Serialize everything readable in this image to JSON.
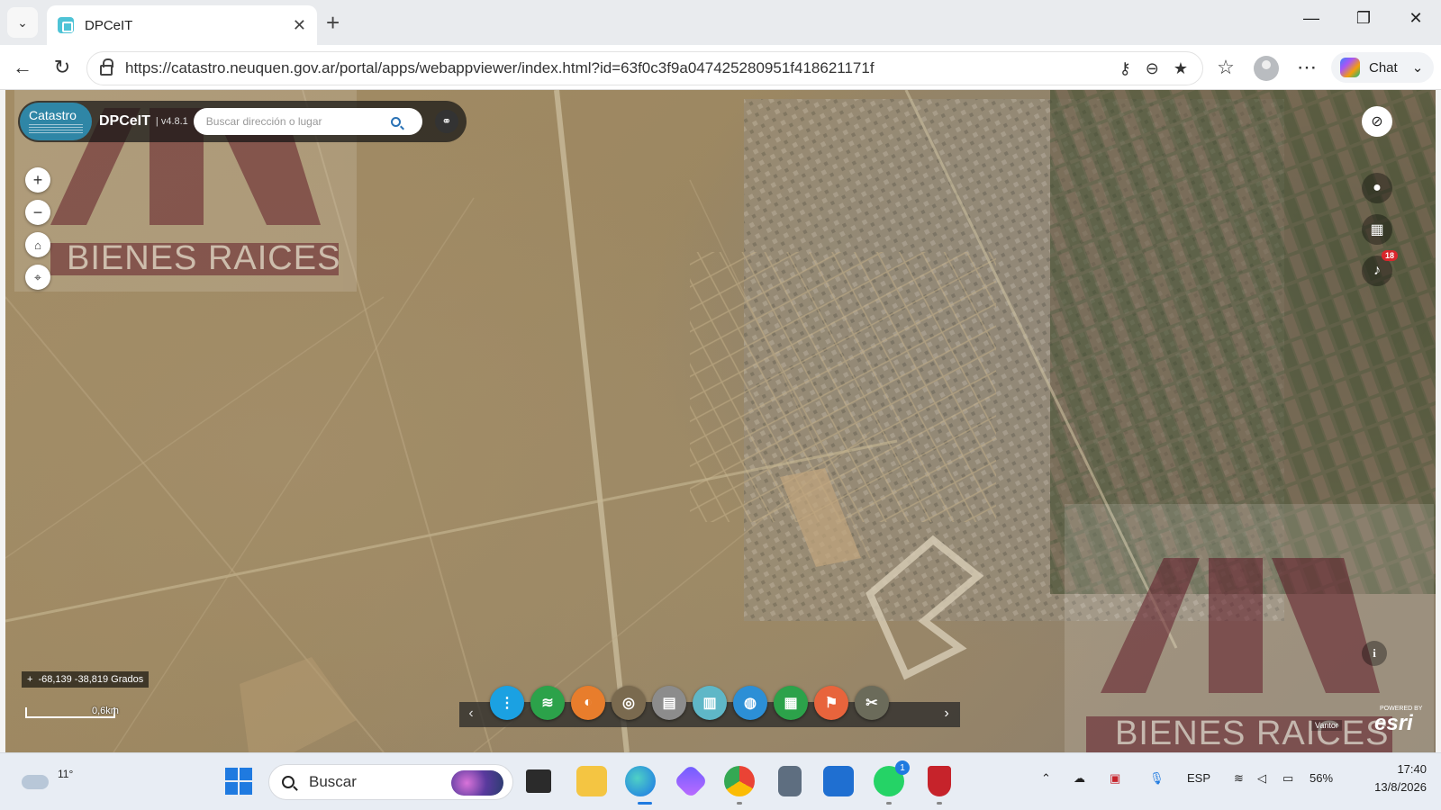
{
  "browser": {
    "tab_title": "DPCeIT",
    "url": "https://catastro.neuquen.gov.ar/portal/apps/webappviewer/index.html?id=63f0c3f9a047425280951f418621171f",
    "chat_label": "Chat"
  },
  "app": {
    "logo_text": "Catastro",
    "name": "DPCeIT",
    "version": "| v4.8.1",
    "search_placeholder": "Buscar dirección o lugar"
  },
  "map": {
    "coords": "-68,139 -38,819 Grados",
    "scale_label": "0,6km",
    "notification_count": "18",
    "attribution": "Vantor",
    "esri_powered": "POWERED BY",
    "esri": "esri"
  },
  "watermark": {
    "text": "BIENES RAICES"
  },
  "toolbar": {
    "tools": [
      {
        "icon": "more-vertical-icon",
        "color": "#1ba1e2",
        "glyph": "⋮"
      },
      {
        "icon": "layers-icon",
        "color": "#2ca24a",
        "glyph": "≋"
      },
      {
        "icon": "basemap-icon",
        "color": "#e87d2c",
        "glyph": "◐"
      },
      {
        "icon": "globe-icon",
        "color": "#7a6a4f",
        "glyph": "◎"
      },
      {
        "icon": "document-icon",
        "color": "#8c8c8c",
        "glyph": "▤"
      },
      {
        "icon": "print-icon",
        "color": "#5fb7c7",
        "glyph": "▥"
      },
      {
        "icon": "world-icon",
        "color": "#2c8fd6",
        "glyph": "◍"
      },
      {
        "icon": "map-sheets-icon",
        "color": "#2ca24a",
        "glyph": "▦"
      },
      {
        "icon": "flag-icon",
        "color": "#e8643c",
        "glyph": "⚑"
      },
      {
        "icon": "measure-tools-icon",
        "color": "#6b6b5a",
        "glyph": "✂"
      }
    ]
  },
  "taskbar": {
    "temperature": "11°",
    "search_label": "Buscar",
    "whatsapp_badge": "1",
    "language": "ESP",
    "battery": "56%",
    "time": "17:40",
    "date": "13/8/2026"
  }
}
